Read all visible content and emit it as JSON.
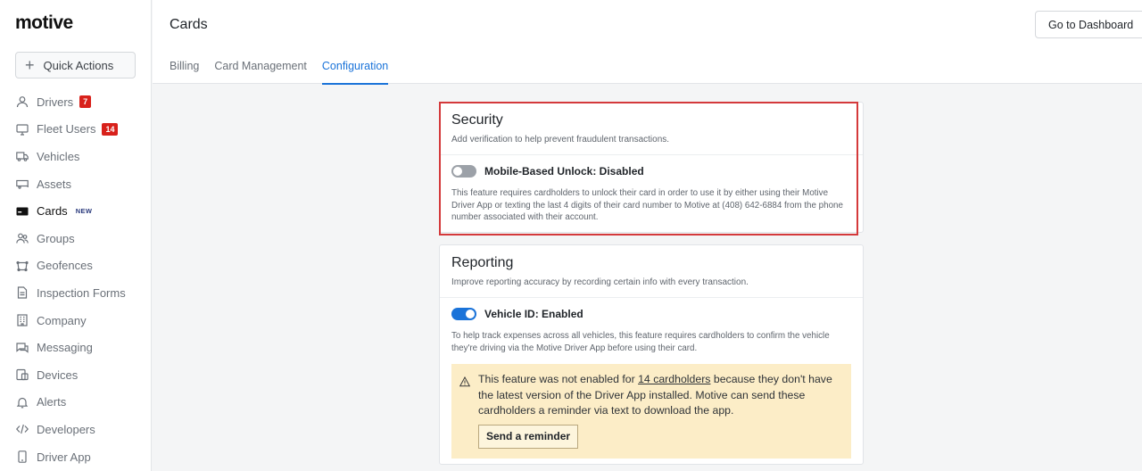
{
  "app": {
    "logo": "motive"
  },
  "sidebar": {
    "quick_actions": "Quick Actions",
    "items": [
      {
        "label": "Drivers",
        "icon": "person-icon",
        "badge": "7"
      },
      {
        "label": "Fleet Users",
        "icon": "monitor-icon",
        "badge": "14"
      },
      {
        "label": "Vehicles",
        "icon": "truck-icon"
      },
      {
        "label": "Assets",
        "icon": "trailer-icon"
      },
      {
        "label": "Cards",
        "icon": "card-icon",
        "tag": "NEW"
      },
      {
        "label": "Groups",
        "icon": "group-icon"
      },
      {
        "label": "Geofences",
        "icon": "geofence-icon"
      },
      {
        "label": "Inspection Forms",
        "icon": "document-icon"
      },
      {
        "label": "Company",
        "icon": "building-icon"
      },
      {
        "label": "Messaging",
        "icon": "chat-icon"
      },
      {
        "label": "Devices",
        "icon": "devices-icon"
      },
      {
        "label": "Alerts",
        "icon": "bell-icon"
      },
      {
        "label": "Developers",
        "icon": "code-icon"
      },
      {
        "label": "Driver App",
        "icon": "phone-icon"
      }
    ]
  },
  "header": {
    "title": "Cards",
    "dashboard_button": "Go to Dashboard",
    "tabs": [
      {
        "label": "Billing"
      },
      {
        "label": "Card Management"
      },
      {
        "label": "Configuration",
        "active": true
      }
    ]
  },
  "security": {
    "title": "Security",
    "subtitle": "Add verification to help prevent fraudulent transactions.",
    "toggle_label": "Mobile-Based Unlock: Disabled",
    "toggle_on": false,
    "description": "This feature requires cardholders to unlock their card in order to use it by either using their Motive Driver App or texting the last 4 digits of their card number to Motive at (408) 642-6884 from the phone number associated with their account."
  },
  "reporting": {
    "title": "Reporting",
    "subtitle": "Improve reporting accuracy by recording certain info with every transaction.",
    "toggle_label": "Vehicle ID: Enabled",
    "toggle_on": true,
    "description": "To help track expenses across all vehicles, this feature requires cardholders to confirm the vehicle they're driving via the Motive Driver App before using their card.",
    "warning": {
      "text_before": "This feature was not enabled for ",
      "link": "14 cardholders",
      "text_after": " because they don't have the latest version of the Driver App installed. Motive can send these cardholders a reminder via text to download the app.",
      "button": "Send a reminder"
    }
  },
  "colors": {
    "accent": "#1a73d9",
    "badge": "#d8211b",
    "highlight": "#d4393b",
    "warning_bg": "#fcedc7"
  }
}
